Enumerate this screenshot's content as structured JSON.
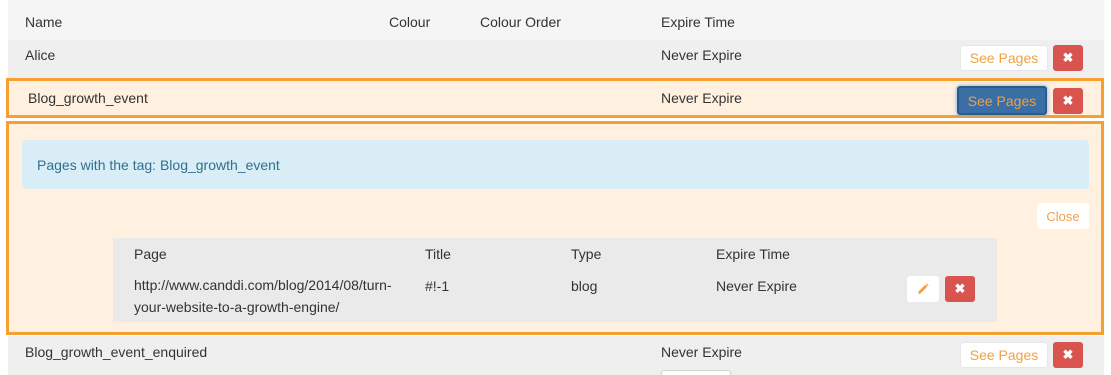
{
  "table": {
    "headers": {
      "name": "Name",
      "colour": "Colour",
      "colour_order": "Colour Order",
      "expire_time": "Expire Time"
    },
    "rows": [
      {
        "name": "Alice",
        "expire": "Never Expire",
        "see_pages": "See Pages"
      },
      {
        "name": "Blog_growth_event",
        "expire": "Never Expire",
        "see_pages": "See Pages"
      },
      {
        "name": "Blog_growth_event_enquired",
        "expire": "Never Expire",
        "see_pages": "See Pages"
      }
    ],
    "delete_icon": "times-icon"
  },
  "pages_panel": {
    "info": "Pages with the tag: Blog_growth_event",
    "close_label": "Close",
    "headers": {
      "page": "Page",
      "title": "Title",
      "type": "Type",
      "expire_time": "Expire Time"
    },
    "rows": [
      {
        "page_line1": "http://www.canddi.com/blog/2014/08/turn-",
        "page_line2": "your-website-to-a-growth-engine/",
        "title": "#!-1",
        "type": "blog",
        "expire": "Never Expire"
      }
    ],
    "edit_icon": "pencil-icon"
  },
  "colors": {
    "accent_orange": "#f0a045",
    "highlight_border": "#f5a030",
    "danger": "#d9534f",
    "info_bg": "#d9edf7",
    "info_text": "#31708f",
    "active_button": "#3a6ea5"
  }
}
